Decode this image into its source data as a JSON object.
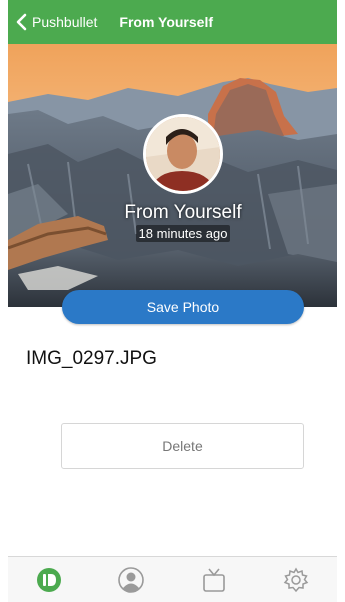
{
  "navbar": {
    "back_label": "Pushbullet",
    "title": "From Yourself",
    "color": "#4caa4f"
  },
  "push": {
    "sender": "From Yourself",
    "time_ago": "18 minutes ago",
    "save_label": "Save Photo",
    "file_name": "IMG_0297.JPG",
    "delete_label": "Delete"
  },
  "tabbar": {
    "items": [
      {
        "icon": "pushes-icon",
        "active": true,
        "color": "#4caa4f"
      },
      {
        "icon": "contacts-icon",
        "active": false
      },
      {
        "icon": "channels-icon",
        "active": false
      },
      {
        "icon": "settings-icon",
        "active": false
      }
    ]
  },
  "colors": {
    "accent": "#2b79c7",
    "brand_green": "#4caa4f"
  }
}
